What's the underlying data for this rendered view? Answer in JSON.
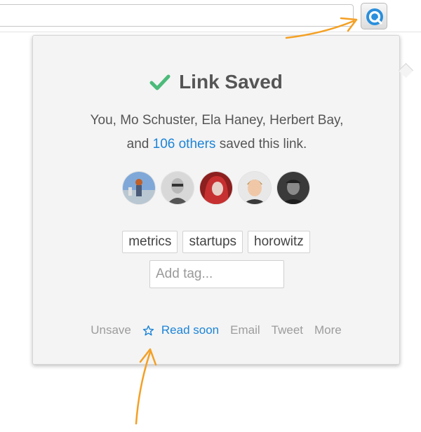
{
  "popup": {
    "title": "Link Saved",
    "saved_by_prefix": "You, Mo Schuster, Ela Haney, Herbert Bay, and ",
    "others_link": "106 others",
    "saved_by_suffix": " saved this link."
  },
  "avatars": [
    {
      "name": "avatar-1"
    },
    {
      "name": "avatar-2"
    },
    {
      "name": "avatar-3"
    },
    {
      "name": "avatar-4"
    },
    {
      "name": "avatar-5"
    }
  ],
  "tags": [
    "metrics",
    "startups",
    "horowitz"
  ],
  "tag_input": {
    "placeholder": "Add tag..."
  },
  "actions": {
    "unsave": "Unsave",
    "read_soon": "Read soon",
    "email": "Email",
    "tweet": "Tweet",
    "more": "More"
  },
  "colors": {
    "accent": "#1c84d8",
    "check": "#4cbb7a",
    "annotation_arrow": "#f4a024"
  }
}
